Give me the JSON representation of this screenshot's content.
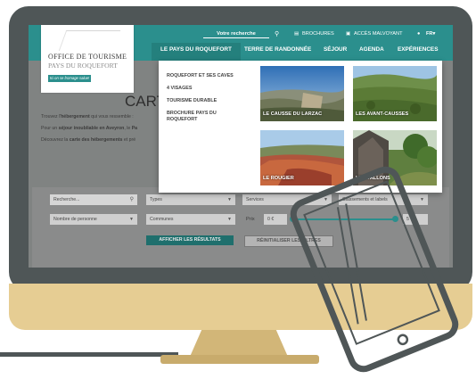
{
  "topbar": {
    "search_placeholder": "Votre recherche",
    "brochures_label": "BROCHURES",
    "accessibility_label": "ACCÈS MALVOYANT",
    "language_label": "FR"
  },
  "logo": {
    "line1": "OFFICE DE TOURISME",
    "line2": "PAYS DU ROQUEFORT",
    "tagline": "Ici on se fromage salue!"
  },
  "nav": {
    "items": [
      "LE PAYS DU ROQUEFORT",
      "TERRE DE RANDONNÉE",
      "SÉJOUR",
      "AGENDA",
      "EXPÉRIENCES"
    ]
  },
  "dropdown": {
    "links": [
      "ROQUEFORT ET SES CAVES",
      "4 VISAGES",
      "TOURISME DURABLE",
      "BROCHURE PAYS DU ROQUEFORT"
    ],
    "tiles": [
      {
        "label": "LE CAUSSE DU LARZAC"
      },
      {
        "label": "LES AVANT-CAUSSES"
      },
      {
        "label": "LE ROUGIER"
      },
      {
        "label": "LES VALLONS"
      }
    ]
  },
  "page": {
    "title_fragment": "CART",
    "line1_prefix": "Trouvez l'",
    "line1_bold": "hébergement",
    "line1_suffix": " qui vous ressemble : ",
    "line2_prefix": "Pour un ",
    "line2_bold": "séjour inoubliable en Aveyron",
    "line2_suffix": ", le ",
    "line2_cut": "Pa",
    "line3_prefix": "Découvrez la ",
    "line3_bold": "carte des hébergements",
    "line3_suffix": " et pré"
  },
  "filters": {
    "search_placeholder": "Recherche...",
    "type_label": "Types",
    "services_label": "Services",
    "classement_label": "Classements et labels",
    "personnes_label": "Nombre de personne",
    "communes_label": "Communes",
    "prix_label": "Prix",
    "price_min": "0 €",
    "price_max": "5 €",
    "show_results": "AFFICHER LES RÉSULTATS",
    "reset_filters": "RÉINITIALISER LES FILTRES"
  },
  "colors": {
    "teal": "#2b8f8d",
    "bezel": "#4f5657",
    "chin": "#e6cd93"
  }
}
